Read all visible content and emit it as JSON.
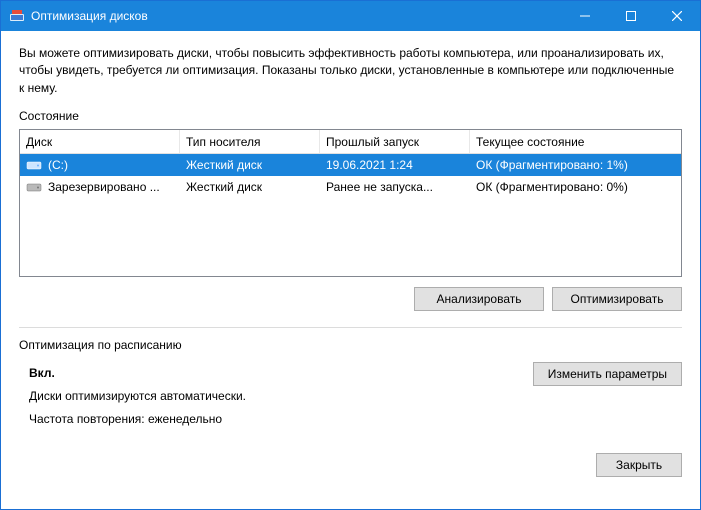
{
  "window": {
    "title": "Оптимизация дисков"
  },
  "description": "Вы можете оптимизировать диски, чтобы повысить эффективность работы  компьютера, или проанализировать их, чтобы увидеть, требуется ли оптимизация. Показаны только диски, установленные в компьютере или подключенные к нему.",
  "state_label": "Состояние",
  "columns": {
    "disk": "Диск",
    "media": "Тип носителя",
    "last": "Прошлый запуск",
    "status": "Текущее состояние"
  },
  "rows": [
    {
      "icon": "drive-c",
      "disk": "(C:)",
      "media": "Жесткий диск",
      "last": "19.06.2021 1:24",
      "status": "ОК (Фрагментировано: 1%)",
      "selected": true
    },
    {
      "icon": "drive-reserved",
      "disk": "Зарезервировано ...",
      "media": "Жесткий диск",
      "last": "Ранее не запуска...",
      "status": "ОК (Фрагментировано: 0%)",
      "selected": false
    }
  ],
  "buttons": {
    "analyze": "Анализировать",
    "optimize": "Оптимизировать",
    "change_settings": "Изменить параметры",
    "close": "Закрыть"
  },
  "schedule": {
    "heading": "Оптимизация по расписанию",
    "state": "Вкл.",
    "line1": "Диски оптимизируются автоматически.",
    "line2": "Частота повторения: еженедельно"
  }
}
